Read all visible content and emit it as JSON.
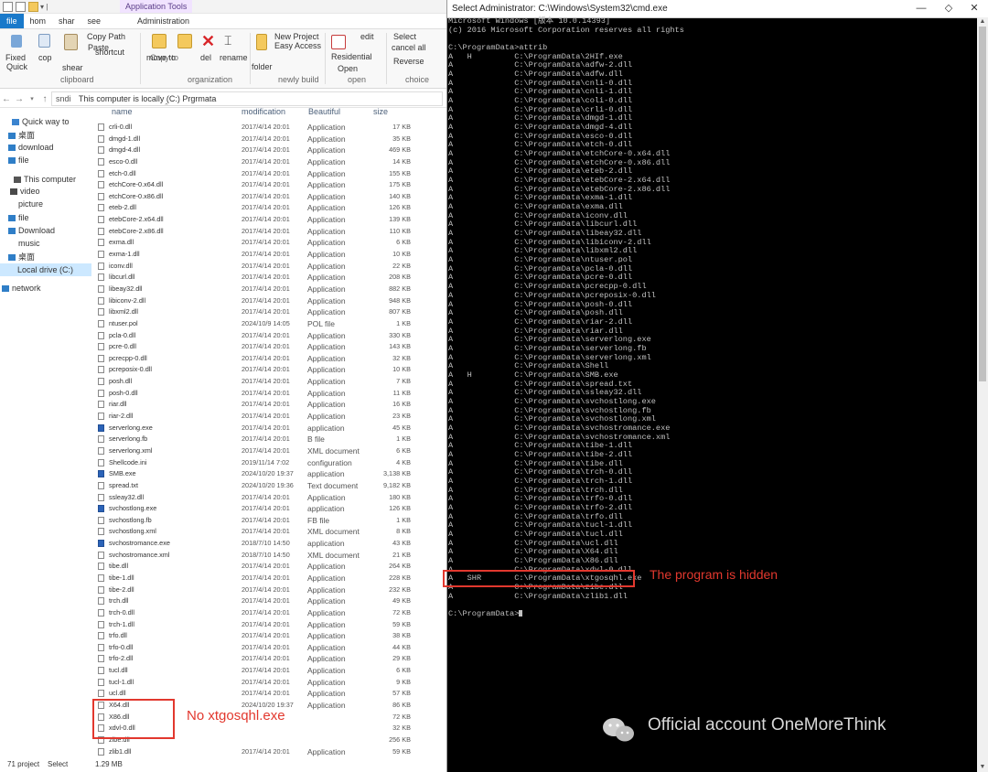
{
  "explorer": {
    "qa_title": "Application Tools",
    "tabs": {
      "file": "file",
      "home": "hom",
      "share": "shar",
      "view": "see",
      "admin": "Administration"
    },
    "ribbon": {
      "fixed": "Fixed",
      "quick": "Quick",
      "copy": "cop",
      "paste": "Paste",
      "copy_path": "Copy Path",
      "shortcut": "shortcut",
      "shear": "shear",
      "move_to": "move to",
      "copy_to": "Copy to",
      "del": "del",
      "rename": "rename",
      "new_project": "New Project",
      "easy_access": "Easy Access",
      "folder": "folder",
      "residential": "Residential",
      "open": "Open",
      "edit": "edit",
      "select": "Select",
      "cancel_all": "cancel all",
      "reverse": "Reverse",
      "group_clipboard": "clipboard",
      "group_organization": "organization",
      "group_new": "newly build",
      "group_open": "open",
      "group_choice": "choice"
    },
    "address": {
      "drive_label": "sndi",
      "path": "This computer is locally (C:) Prgrmata"
    },
    "columns": {
      "name": "name",
      "modified": "modification",
      "type": "Beautiful",
      "size": "size"
    },
    "nav": [
      {
        "label": "Quick way to",
        "icon": "star"
      },
      {
        "label": "桌面",
        "icon": "desktop"
      },
      {
        "label": "download",
        "icon": "download"
      },
      {
        "label": "file",
        "icon": "folder"
      },
      {
        "label": "",
        "icon": ""
      },
      {
        "label": "This computer",
        "icon": "computer"
      },
      {
        "label": "video",
        "icon": "video"
      },
      {
        "label": "picture",
        "icon": ""
      },
      {
        "label": "file",
        "icon": "folder"
      },
      {
        "label": "Download",
        "icon": "download"
      },
      {
        "label": "music",
        "icon": ""
      },
      {
        "label": "桌面",
        "icon": "desktop"
      },
      {
        "label": "Local drive (C:)",
        "icon": "",
        "selected": true
      },
      {
        "label": "",
        "icon": ""
      },
      {
        "label": "network",
        "icon": "network"
      }
    ],
    "files": [
      {
        "name": "crli-0.dll",
        "date": "2017/4/14 20:01",
        "type": "Application",
        "size": "17 KB"
      },
      {
        "name": "dmgd-1.dll",
        "date": "2017/4/14 20:01",
        "type": "Application",
        "size": "35 KB"
      },
      {
        "name": "dmgd-4.dll",
        "date": "2017/4/14 20:01",
        "type": "Application",
        "size": "469 KB"
      },
      {
        "name": "esco-0.dll",
        "date": "2017/4/14 20:01",
        "type": "Application",
        "size": "14 KB"
      },
      {
        "name": "etch-0.dll",
        "date": "2017/4/14 20:01",
        "type": "Application",
        "size": "155 KB"
      },
      {
        "name": "etchCore-0.x64.dll",
        "date": "2017/4/14 20:01",
        "type": "Application",
        "size": "175 KB"
      },
      {
        "name": "etchCore-0.x86.dll",
        "date": "2017/4/14 20:01",
        "type": "Application",
        "size": "140 KB"
      },
      {
        "name": "eteb-2.dll",
        "date": "2017/4/14 20:01",
        "type": "Application",
        "size": "126 KB"
      },
      {
        "name": "etebCore-2.x64.dll",
        "date": "2017/4/14 20:01",
        "type": "Application",
        "size": "139 KB"
      },
      {
        "name": "etebCore-2.x86.dll",
        "date": "2017/4/14 20:01",
        "type": "Application",
        "size": "110 KB"
      },
      {
        "name": "exma.dll",
        "date": "2017/4/14 20:01",
        "type": "Application",
        "size": "6 KB"
      },
      {
        "name": "exma-1.dll",
        "date": "2017/4/14 20:01",
        "type": "Application",
        "size": "10 KB"
      },
      {
        "name": "iconv.dll",
        "date": "2017/4/14 20:01",
        "type": "Application",
        "size": "22 KB"
      },
      {
        "name": "libcurl.dll",
        "date": "2017/4/14 20:01",
        "type": "Application",
        "size": "208 KB"
      },
      {
        "name": "libeay32.dll",
        "date": "2017/4/14 20:01",
        "type": "Application",
        "size": "882 KB"
      },
      {
        "name": "libiconv-2.dll",
        "date": "2017/4/14 20:01",
        "type": "Application",
        "size": "948 KB"
      },
      {
        "name": "libxml2.dll",
        "date": "2017/4/14 20:01",
        "type": "Application",
        "size": "807 KB"
      },
      {
        "name": "ntuser.pol",
        "date": "2024/10/9 14:05",
        "type": "POL file",
        "size": "1 KB"
      },
      {
        "name": "pcla-0.dll",
        "date": "2017/4/14 20:01",
        "type": "Application",
        "size": "330 KB"
      },
      {
        "name": "pcre-0.dll",
        "date": "2017/4/14 20:01",
        "type": "Application",
        "size": "143 KB"
      },
      {
        "name": "pcrecpp-0.dll",
        "date": "2017/4/14 20:01",
        "type": "Application",
        "size": "32 KB"
      },
      {
        "name": "pcreposix-0.dll",
        "date": "2017/4/14 20:01",
        "type": "Application",
        "size": "10 KB"
      },
      {
        "name": "posh.dll",
        "date": "2017/4/14 20:01",
        "type": "Application",
        "size": "7 KB"
      },
      {
        "name": "posh-0.dll",
        "date": "2017/4/14 20:01",
        "type": "Application",
        "size": "11 KB"
      },
      {
        "name": "riar.dll",
        "date": "2017/4/14 20:01",
        "type": "Application",
        "size": "16 KB"
      },
      {
        "name": "riar-2.dll",
        "date": "2017/4/14 20:01",
        "type": "Application",
        "size": "23 KB"
      },
      {
        "name": "serverlong.exe",
        "date": "2017/4/14 20:01",
        "type": "application",
        "size": "45 KB",
        "exe": true
      },
      {
        "name": "serverlong.fb",
        "date": "2017/4/14 20:01",
        "type": "B file",
        "size": "1 KB"
      },
      {
        "name": "serverlong.xml",
        "date": "2017/4/14 20:01",
        "type": "XML document",
        "size": "6 KB"
      },
      {
        "name": "Shellcode.ini",
        "date": "2019/11/14 7:02",
        "type": "configuration",
        "size": "4 KB"
      },
      {
        "name": "SMB.exe",
        "date": "2024/10/20 19:37",
        "type": "application",
        "size": "3,138 KB",
        "exe": true
      },
      {
        "name": "spread.txt",
        "date": "2024/10/20 19:36",
        "type": "Text document",
        "size": "9,182 KB"
      },
      {
        "name": "ssleay32.dll",
        "date": "2017/4/14 20:01",
        "type": "Application",
        "size": "180 KB"
      },
      {
        "name": "svchostlong.exe",
        "date": "2017/4/14 20:01",
        "type": "application",
        "size": "126 KB",
        "exe": true
      },
      {
        "name": "svchostlong.fb",
        "date": "2017/4/14 20:01",
        "type": "FB file",
        "size": "1 KB"
      },
      {
        "name": "svchostlong.xml",
        "date": "2017/4/14 20:01",
        "type": "XML document",
        "size": "8 KB"
      },
      {
        "name": "svchostromance.exe",
        "date": "2018/7/10 14:50",
        "type": "application",
        "size": "43 KB",
        "exe": true
      },
      {
        "name": "svchostromance.xml",
        "date": "2018/7/10 14:50",
        "type": "XML document",
        "size": "21 KB"
      },
      {
        "name": "tibe.dll",
        "date": "2017/4/14 20:01",
        "type": "Application",
        "size": "264 KB"
      },
      {
        "name": "tibe-1.dll",
        "date": "2017/4/14 20:01",
        "type": "Application",
        "size": "228 KB"
      },
      {
        "name": "tibe-2.dll",
        "date": "2017/4/14 20:01",
        "type": "Application",
        "size": "232 KB"
      },
      {
        "name": "trch.dll",
        "date": "2017/4/14 20:01",
        "type": "Application",
        "size": "49 KB"
      },
      {
        "name": "trch-0.dll",
        "date": "2017/4/14 20:01",
        "type": "Application",
        "size": "72 KB"
      },
      {
        "name": "trch-1.dll",
        "date": "2017/4/14 20:01",
        "type": "Application",
        "size": "59 KB"
      },
      {
        "name": "trfo.dll",
        "date": "2017/4/14 20:01",
        "type": "Application",
        "size": "38 KB"
      },
      {
        "name": "trfo-0.dll",
        "date": "2017/4/14 20:01",
        "type": "Application",
        "size": "44 KB"
      },
      {
        "name": "trfo-2.dll",
        "date": "2017/4/14 20:01",
        "type": "Application",
        "size": "29 KB"
      },
      {
        "name": "tucl.dll",
        "date": "2017/4/14 20:01",
        "type": "Application",
        "size": "6 KB"
      },
      {
        "name": "tucl-1.dll",
        "date": "2017/4/14 20:01",
        "type": "Application",
        "size": "9 KB"
      },
      {
        "name": "ucl.dll",
        "date": "2017/4/14 20:01",
        "type": "Application",
        "size": "57 KB"
      },
      {
        "name": "X64.dll",
        "date": "2024/10/20 19:37",
        "type": "Application",
        "size": "86 KB"
      },
      {
        "name": "X86.dll",
        "date": "",
        "type": "",
        "size": "72 KB"
      },
      {
        "name": "xdvl-0.dll",
        "date": "",
        "type": "",
        "size": "32 KB"
      },
      {
        "name": "zibe.dll",
        "date": "",
        "type": "",
        "size": "256 KB"
      },
      {
        "name": "zlib1.dll",
        "date": "2017/4/14 20:01",
        "type": "Application",
        "size": "59 KB"
      }
    ],
    "status": {
      "count": "71 project",
      "selected": "Select",
      "size": "1.29 MB"
    },
    "annotation": "No xtgosqhl.exe"
  },
  "cmd": {
    "title": "Select Administrator: C:\\Windows\\System32\\cmd.exe",
    "lines": [
      "Microsoft Windows [版本 10.0.14393]",
      "(c) 2016 Microsoft Corporation reserves all rights",
      "",
      "C:\\ProgramData>attrib",
      "A   H         C:\\ProgramData\\2HIf.exe",
      "A             C:\\ProgramData\\adfw-2.dll",
      "A             C:\\ProgramData\\adfw.dll",
      "A             C:\\ProgramData\\cnli-0.dll",
      "A             C:\\ProgramData\\cnli-1.dll",
      "A             C:\\ProgramData\\coli-0.dll",
      "A             C:\\ProgramData\\crli-0.dll",
      "A             C:\\ProgramData\\dmgd-1.dll",
      "A             C:\\ProgramData\\dmgd-4.dll",
      "A             C:\\ProgramData\\esco-0.dll",
      "A             C:\\ProgramData\\etch-0.dll",
      "A             C:\\ProgramData\\etchCore-0.x64.dll",
      "A             C:\\ProgramData\\etchCore-0.x86.dll",
      "A             C:\\ProgramData\\eteb-2.dll",
      "A             C:\\ProgramData\\etebCore-2.x64.dll",
      "A             C:\\ProgramData\\etebCore-2.x86.dll",
      "A             C:\\ProgramData\\exma-1.dll",
      "A             C:\\ProgramData\\exma.dll",
      "A             C:\\ProgramData\\iconv.dll",
      "A             C:\\ProgramData\\libcurl.dll",
      "A             C:\\ProgramData\\libeay32.dll",
      "A             C:\\ProgramData\\libiconv-2.dll",
      "A             C:\\ProgramData\\libxml2.dll",
      "A             C:\\ProgramData\\ntuser.pol",
      "A             C:\\ProgramData\\pcla-0.dll",
      "A             C:\\ProgramData\\pcre-0.dll",
      "A             C:\\ProgramData\\pcrecpp-0.dll",
      "A             C:\\ProgramData\\pcreposix-0.dll",
      "A             C:\\ProgramData\\posh-0.dll",
      "A             C:\\ProgramData\\posh.dll",
      "A             C:\\ProgramData\\riar-2.dll",
      "A             C:\\ProgramData\\riar.dll",
      "A             C:\\ProgramData\\serverlong.exe",
      "A             C:\\ProgramData\\serverlong.fb",
      "A             C:\\ProgramData\\serverlong.xml",
      "A             C:\\ProgramData\\Shell",
      "A   H         C:\\ProgramData\\SMB.exe",
      "A             C:\\ProgramData\\spread.txt",
      "A             C:\\ProgramData\\ssleay32.dll",
      "A             C:\\ProgramData\\svchostlong.exe",
      "A             C:\\ProgramData\\svchostlong.fb",
      "A             C:\\ProgramData\\svchostlong.xml",
      "A             C:\\ProgramData\\svchostromance.exe",
      "A             C:\\ProgramData\\svchostromance.xml",
      "A             C:\\ProgramData\\tibe-1.dll",
      "A             C:\\ProgramData\\tibe-2.dll",
      "A             C:\\ProgramData\\tibe.dll",
      "A             C:\\ProgramData\\trch-0.dll",
      "A             C:\\ProgramData\\trch-1.dll",
      "A             C:\\ProgramData\\trch.dll",
      "A             C:\\ProgramData\\trfo-0.dll",
      "A             C:\\ProgramData\\trfo-2.dll",
      "A             C:\\ProgramData\\trfo.dll",
      "A             C:\\ProgramData\\tucl-1.dll",
      "A             C:\\ProgramData\\tucl.dll",
      "A             C:\\ProgramData\\ucl.dll",
      "A             C:\\ProgramData\\X64.dll",
      "A             C:\\ProgramData\\X86.dll",
      "A             C:\\ProgramData\\xdvl-0.dll",
      "A   SHR       C:\\ProgramData\\xtgosqhl.exe",
      "A             C:\\ProgramData\\zibe.dll",
      "A             C:\\ProgramData\\zlib1.dll",
      "",
      "C:\\ProgramData>"
    ],
    "annotation": "The program is hidden"
  },
  "watermark": "Official account OneMoreThink",
  "colors": {
    "accent_red": "#e2382e",
    "file_tab": "#1979ca",
    "console_bg": "#000000",
    "console_fg": "#c0c0c0"
  }
}
